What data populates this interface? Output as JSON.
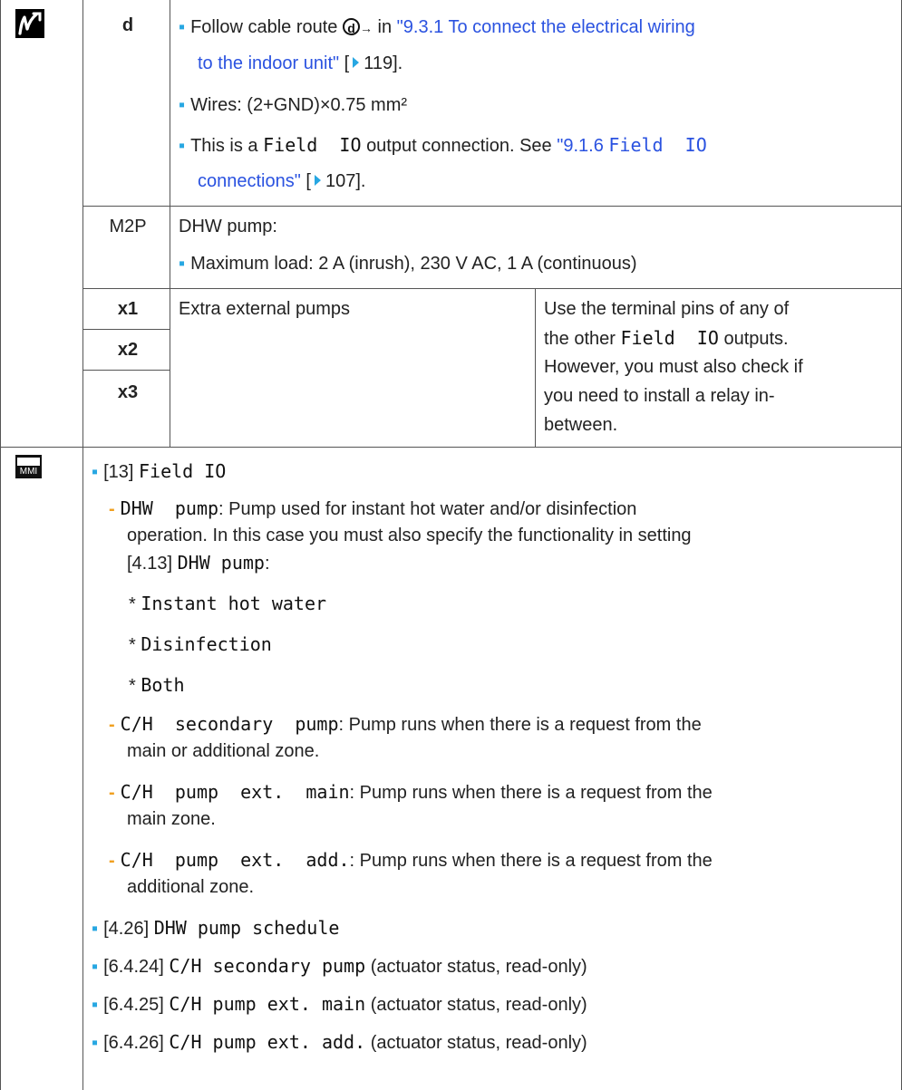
{
  "table": {
    "row_d": {
      "code": "d",
      "b1_prefix": "Follow cable route",
      "b1_route_symbol": "d",
      "b1_arrow": "→",
      "b1_in": "in",
      "b1_link_line1": "\"9.3.1 To connect the electrical wiring",
      "b1_link_line2": "to the indoor unit\"",
      "b1_page": "119].",
      "b2": "Wires: (2+GND)×0.75 mm²",
      "b3_prefix": "This is a",
      "b3_mono": "Field  IO",
      "b3_suffix": "output connection. See",
      "b3_link_num": "\"9.1.6",
      "b3_link_mono": "Field  IO",
      "b3_link_line2": "connections\"",
      "b3_page": "107]."
    },
    "row_m2p": {
      "code": "M2P",
      "title": "DHW pump:",
      "bullet": "Maximum load: 2 A (inrush), 230 V AC, 1 A (continuous)"
    },
    "row_x": {
      "codes": [
        "x1",
        "x2",
        "x3"
      ],
      "desc": "Extra external pumps",
      "note_line1": "Use the terminal pins of any of",
      "note_line2_prefix": "the other",
      "note_line2_mono": "Field  IO",
      "note_line2_suffix": "outputs.",
      "note_line3": "However, you must also check if",
      "note_line4": "you need to install a relay in-",
      "note_line5": "between."
    }
  },
  "mmi": {
    "icon_label": "MMI",
    "item1_ref": "[13]",
    "item1_mono": "Field IO",
    "sub1_mono": "DHW  pump",
    "sub1_line1": ": Pump used for instant hot water and/or disinfection",
    "sub1_line2": "operation. In this case you must also specify the functionality in setting",
    "sub1_ref": "[4.13]",
    "sub1_ref_mono": "DHW pump",
    "sub1_ref_colon": ":",
    "options": [
      "Instant hot water",
      "Disinfection",
      "Both"
    ],
    "sub2_mono": "C/H  secondary  pump",
    "sub2_line1": ": Pump runs when there is a request from the",
    "sub2_line2": "main or additional zone.",
    "sub3_mono": "C/H  pump  ext.  main",
    "sub3_line1": ": Pump runs when there is a request from the",
    "sub3_line2": "main zone.",
    "sub4_mono": "C/H  pump  ext.  add.",
    "sub4_line1": ": Pump runs when there is a request from the",
    "sub4_line2": "additional zone.",
    "item2_ref": "[4.26]",
    "item2_mono": "DHW pump schedule",
    "item3_ref": "[6.4.24]",
    "item3_mono": "C/H secondary pump",
    "item3_suffix": "(actuator status, read-only)",
    "item4_ref": "[6.4.25]",
    "item4_mono": "C/H pump ext. main",
    "item4_suffix": "(actuator status, read-only)",
    "item5_ref": "[6.4.26]",
    "item5_mono": "C/H pump ext. add.",
    "item5_suffix": "(actuator status, read-only)"
  },
  "colors": {
    "bullet": "#27a7e2",
    "dash": "#f0a020",
    "link": "#2a52e0",
    "border": "#555555"
  },
  "icons": [
    "wiring-icon",
    "mmi-icon",
    "page-ref-triangle-icon",
    "cable-route-d-icon"
  ]
}
